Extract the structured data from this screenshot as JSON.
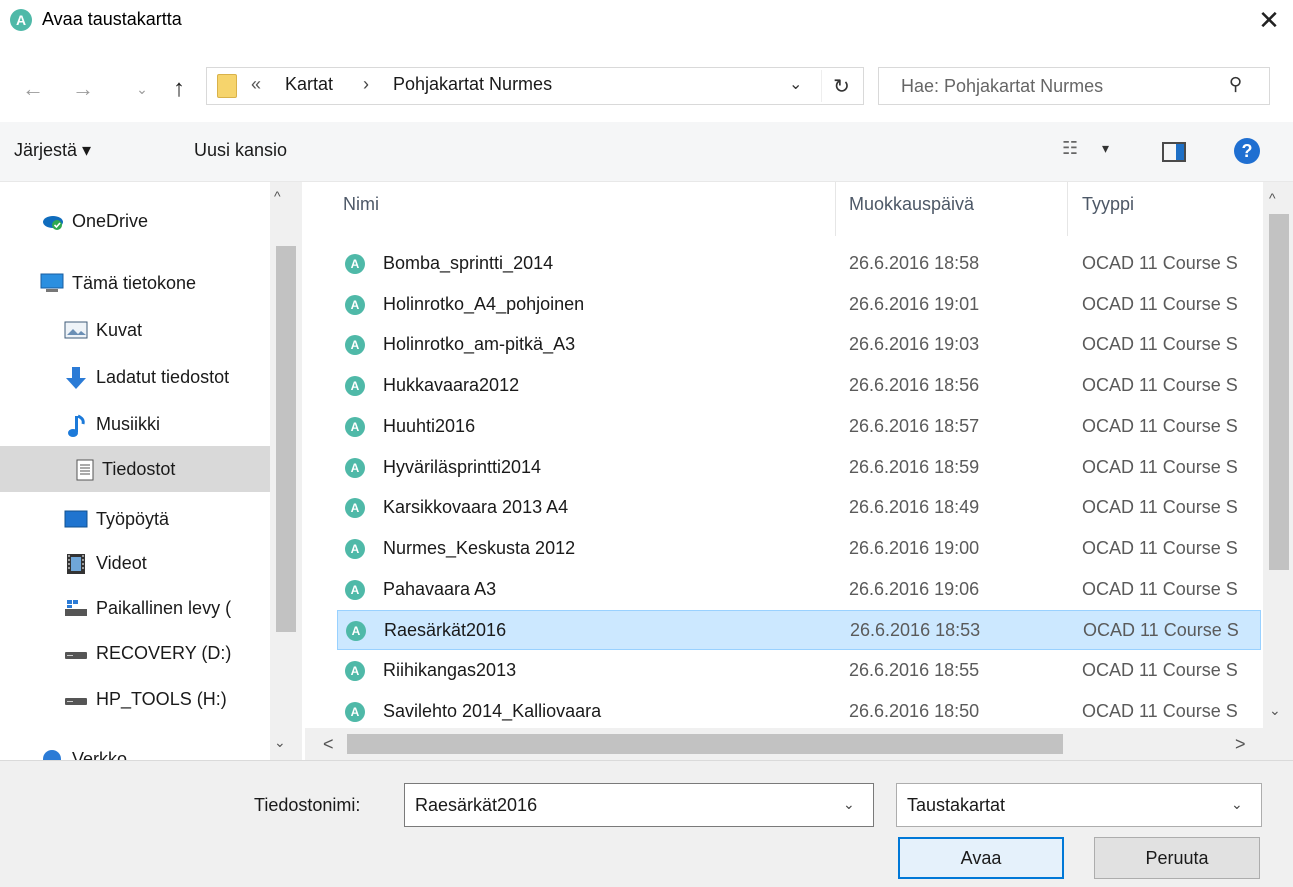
{
  "window": {
    "title": "Avaa taustakartta",
    "app_icon_letter": "A",
    "close_glyph": "✕"
  },
  "nav": {
    "back_glyph": "←",
    "forward_glyph": "→",
    "recent_glyph": "⌄",
    "up_glyph": "↑",
    "path_prefix": "«",
    "breadcrumbs": [
      "Kartat",
      "Pohjakartat Nurmes"
    ],
    "breadcrumb_separator": "›",
    "dropdown_glyph": "⌄",
    "refresh_glyph": "↻",
    "search_placeholder": "Hae: Pohjakartat Nurmes",
    "search_icon": "search-icon"
  },
  "toolbar": {
    "organize_label": "Järjestä ▾",
    "new_folder_label": "Uusi kansio",
    "view_glyph": "☷",
    "view_dropdown_glyph": "▾",
    "help_glyph": "?"
  },
  "sidebar": {
    "items": [
      {
        "label": "OneDrive",
        "icon": "onedrive-icon",
        "selected": false
      },
      {
        "label": "Tämä tietokone",
        "icon": "computer-icon",
        "selected": false
      },
      {
        "label": "Kuvat",
        "icon": "pictures-icon",
        "selected": false
      },
      {
        "label": "Ladatut tiedostot",
        "icon": "downloads-icon",
        "selected": false
      },
      {
        "label": "Musiikki",
        "icon": "music-icon",
        "selected": false
      },
      {
        "label": "Tiedostot",
        "icon": "documents-icon",
        "selected": true
      },
      {
        "label": "Työpöytä",
        "icon": "desktop-icon",
        "selected": false
      },
      {
        "label": "Videot",
        "icon": "videos-icon",
        "selected": false
      },
      {
        "label": "Paikallinen levy (",
        "icon": "local-disk-icon",
        "selected": false
      },
      {
        "label": "RECOVERY (D:)",
        "icon": "drive-icon",
        "selected": false
      },
      {
        "label": "HP_TOOLS (H:)",
        "icon": "drive-icon",
        "selected": false
      },
      {
        "label": "Verkko",
        "icon": "network-icon",
        "selected": false
      }
    ]
  },
  "filelist": {
    "columns": [
      "Nimi",
      "Muokkauspäivä",
      "Tyyppi"
    ],
    "sort_glyph": "^",
    "rows": [
      {
        "name": "Bomba_sprintti_2014",
        "date": "26.6.2016 18:58",
        "type": "OCAD 11 Course S",
        "selected": false
      },
      {
        "name": "Holinrotko_A4_pohjoinen",
        "date": "26.6.2016 19:01",
        "type": "OCAD 11 Course S",
        "selected": false
      },
      {
        "name": "Holinrotko_am-pitkä_A3",
        "date": "26.6.2016 19:03",
        "type": "OCAD 11 Course S",
        "selected": false
      },
      {
        "name": "Hukkavaara2012",
        "date": "26.6.2016 18:56",
        "type": "OCAD 11 Course S",
        "selected": false
      },
      {
        "name": "Huuhti2016",
        "date": "26.6.2016 18:57",
        "type": "OCAD 11 Course S",
        "selected": false
      },
      {
        "name": "Hyväriläsprintti2014",
        "date": "26.6.2016 18:59",
        "type": "OCAD 11 Course S",
        "selected": false
      },
      {
        "name": "Karsikkovaara 2013 A4",
        "date": "26.6.2016 18:49",
        "type": "OCAD 11 Course S",
        "selected": false
      },
      {
        "name": "Nurmes_Keskusta 2012",
        "date": "26.6.2016 19:00",
        "type": "OCAD 11 Course S",
        "selected": false
      },
      {
        "name": "Pahavaara A3",
        "date": "26.6.2016 19:06",
        "type": "OCAD 11 Course S",
        "selected": false
      },
      {
        "name": "Raesärkät2016",
        "date": "26.6.2016 18:53",
        "type": "OCAD 11 Course S",
        "selected": true
      },
      {
        "name": "Riihikangas2013",
        "date": "26.6.2016 18:55",
        "type": "OCAD 11 Course S",
        "selected": false
      },
      {
        "name": "Savilehto 2014_Kalliovaara",
        "date": "26.6.2016 18:50",
        "type": "OCAD 11 Course S",
        "selected": false
      }
    ]
  },
  "scroll": {
    "up": "^",
    "down": "⌄",
    "left": "<",
    "right": ">"
  },
  "bottom": {
    "filename_label": "Tiedostonimi:",
    "filename_value": "Raesärkät2016",
    "filetype_value": "Taustakartat",
    "dropdown_glyph": "⌄",
    "open_label": "Avaa",
    "cancel_label": "Peruuta"
  },
  "colors": {
    "app_accent": "#4fb9a8",
    "selection_bg": "#cce8ff",
    "primary_button_border": "#0078d7"
  }
}
